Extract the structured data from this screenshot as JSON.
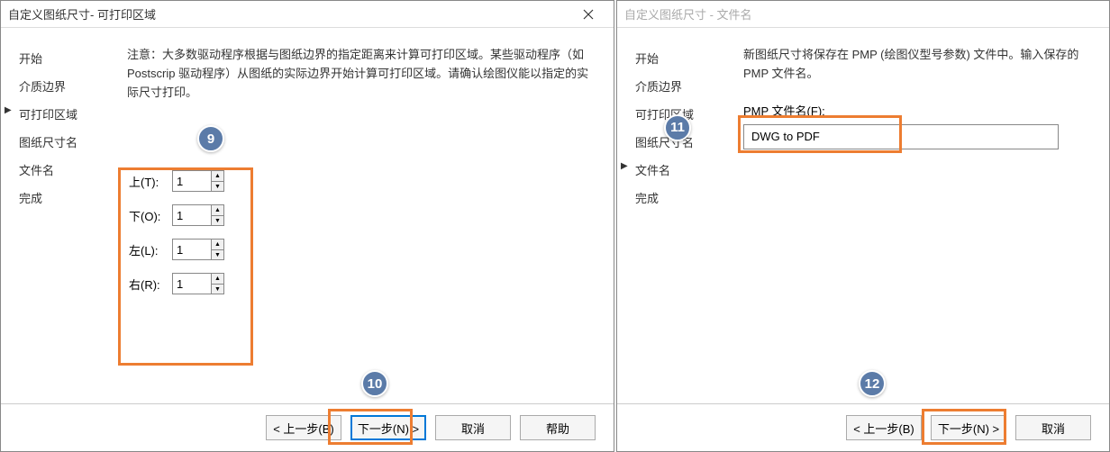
{
  "left": {
    "title": "自定义图纸尺寸- 可打印区域",
    "sidebar": [
      "开始",
      "介质边界",
      "可打印区域",
      "图纸尺寸名",
      "文件名",
      "完成"
    ],
    "activeIndex": 2,
    "description": "注意：大多数驱动程序根据与图纸边界的指定距离来计算可打印区域。某些驱动程序（如 Postscrip 驱动程序）从图纸的实际边界开始计算可打印区域。请确认绘图仪能以指定的实际尺寸打印。",
    "margins": {
      "topLabel": "上(T):",
      "bottomLabel": "下(O):",
      "leftLabel": "左(L):",
      "rightLabel": "右(R):",
      "top": "1",
      "bottom": "1",
      "left": "1",
      "right": "1"
    },
    "buttons": {
      "back": "< 上一步(B)",
      "next": "下一步(N) >",
      "cancel": "取消",
      "help": "帮助"
    },
    "badge9": "9",
    "badge10": "10"
  },
  "right": {
    "title": "自定义图纸尺寸 - 文件名",
    "sidebar": [
      "开始",
      "介质边界",
      "可打印区域",
      "图纸尺寸名",
      "文件名",
      "完成"
    ],
    "activeIndex": 4,
    "description": "新图纸尺寸将保存在 PMP (绘图仪型号参数) 文件中。输入保存的 PMP 文件名。",
    "pmpLabel": "PMP 文件名(F):",
    "pmpValue": "DWG to PDF",
    "buttons": {
      "back": "< 上一步(B)",
      "next": "下一步(N) >",
      "cancel": "取消"
    },
    "badge11": "11",
    "badge12": "12"
  }
}
